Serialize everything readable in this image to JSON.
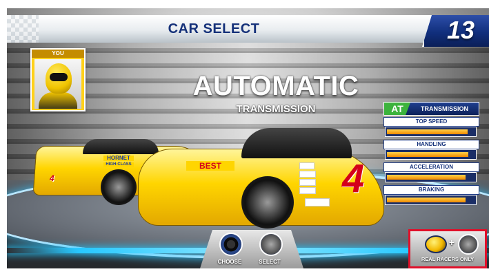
{
  "header": {
    "title": "CAR SELECT",
    "timer": "13"
  },
  "player": {
    "name": "YOU"
  },
  "transmission": {
    "main": "AUTOMATIC",
    "sub": "TRANSMISSION"
  },
  "stats_panel": {
    "badge": "AT",
    "title": "TRANSMISSION",
    "stats": [
      {
        "label": "TOP SPEED",
        "level": 0.92
      },
      {
        "label": "HANDLING",
        "level": 0.93
      },
      {
        "label": "ACCELERATION",
        "level": 0.9
      },
      {
        "label": "BRAKING",
        "level": 0.9
      }
    ]
  },
  "cars": {
    "front_number": "4",
    "rear_number": "4",
    "front_sponsor": "BEST",
    "rear_sponsor_1": "HORNET",
    "rear_sponsor_2": "HIGH-CLASS"
  },
  "controls": {
    "choose_label": "CHOOSE",
    "select_label": "SELECT",
    "real_racers_label": "REAL RACERS ONLY",
    "plus": "+"
  },
  "colors": {
    "header_text": "#16327a",
    "car_yellow": "#ffd500",
    "highlight_red": "#e0102a",
    "neon_blue": "#27c8ff"
  }
}
